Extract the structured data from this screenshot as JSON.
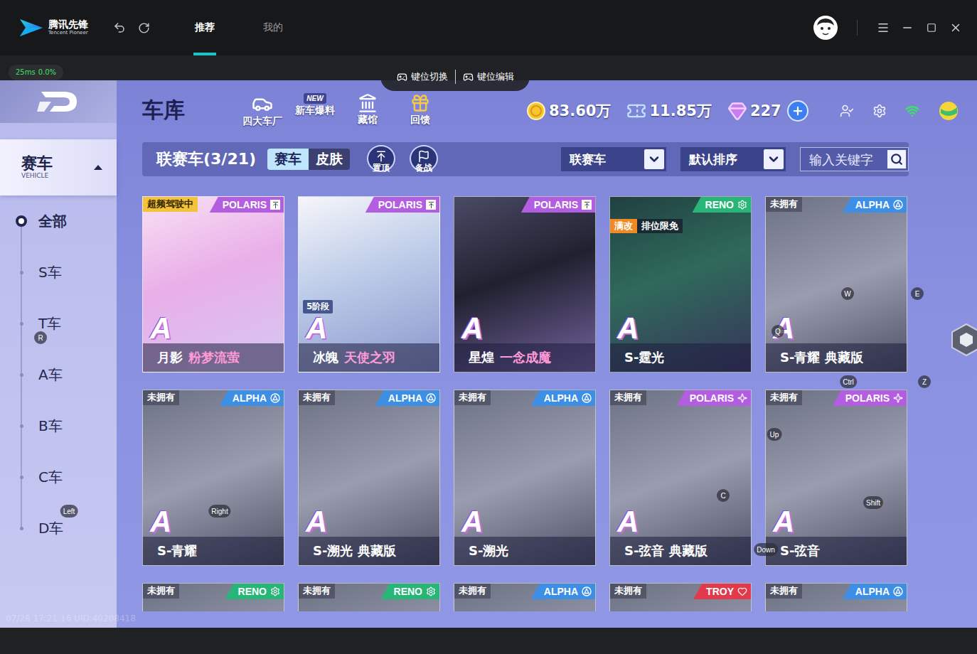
{
  "app": {
    "logo_text": "腾讯先锋",
    "logo_sub": "Tencent Pioneer"
  },
  "nav_tabs": [
    {
      "label": "推荐",
      "selected": true
    },
    {
      "label": "我的",
      "selected": false
    }
  ],
  "ping": {
    "latency": "25ms",
    "loss": "0.0%"
  },
  "key_mode_buttons": [
    "键位切换",
    "键位编辑"
  ],
  "garage": {
    "title": "车库",
    "shortcuts": [
      {
        "label": "四大车厂",
        "kind": "factory"
      },
      {
        "label": "新车爆料",
        "kind": "news"
      },
      {
        "label": "藏馆",
        "kind": "museum"
      },
      {
        "label": "回馈",
        "kind": "gift"
      }
    ],
    "new_badge": "NEW",
    "currencies": [
      {
        "value": "83.60万",
        "kind": "coin"
      },
      {
        "value": "11.85万",
        "kind": "ticket"
      },
      {
        "value": "227",
        "kind": "diamond"
      }
    ]
  },
  "sidebar": {
    "category": {
      "label": "赛车",
      "sub": "VEHICLE",
      "expanded": true
    },
    "items": [
      {
        "label": "全部",
        "selected": true
      },
      {
        "label": "S车",
        "selected": false
      },
      {
        "label": "T车",
        "selected": false
      },
      {
        "label": "A车",
        "selected": false
      },
      {
        "label": "B车",
        "selected": false
      },
      {
        "label": "C车",
        "selected": false
      },
      {
        "label": "D车",
        "selected": false
      }
    ]
  },
  "filter": {
    "title": "联赛车(3/21)",
    "toggle": [
      {
        "label": "赛车",
        "selected": true
      },
      {
        "label": "皮肤",
        "selected": false
      }
    ],
    "actions": [
      {
        "label": "置顶",
        "kind": "pin"
      },
      {
        "label": "备战",
        "kind": "flag"
      }
    ],
    "dropdowns": [
      "联赛车",
      "默认排序"
    ],
    "search_placeholder": "输入关键字"
  },
  "cards": [
    {
      "status": "超频驾驶中",
      "brand": "POLARIS",
      "brand_color": "#b35ee0",
      "pinned": true,
      "owned": true,
      "grade": "A",
      "name": "月影",
      "subname": "粉梦流萤"
    },
    {
      "brand": "POLARIS",
      "brand_color": "#b35ee0",
      "pinned": true,
      "owned": true,
      "stage": "5阶段",
      "grade": "A",
      "name": "冰魄",
      "subname": "天使之羽"
    },
    {
      "brand": "POLARIS",
      "brand_color": "#b35ee0",
      "pinned": true,
      "owned": true,
      "grade": "A",
      "name": "星煌",
      "subname": "一念成魔"
    },
    {
      "brand": "RENO",
      "brand_color": "#27b677",
      "pinned": false,
      "owned": true,
      "badges": [
        {
          "label": "满改",
          "kind": "highlight"
        },
        {
          "label": "排位限免",
          "kind": "plain"
        }
      ],
      "grade": "A",
      "name": "S-霆光"
    },
    {
      "status": "未拥有",
      "brand": "ALPHA",
      "brand_color": "#3d8fe6",
      "pinned": false,
      "owned": false,
      "grade": "A",
      "name": "S-青耀 典藏版"
    },
    {
      "status": "未拥有",
      "brand": "ALPHA",
      "brand_color": "#3d8fe6",
      "pinned": false,
      "owned": false,
      "grade": "A",
      "name": "S-青耀"
    },
    {
      "status": "未拥有",
      "brand": "ALPHA",
      "brand_color": "#3d8fe6",
      "pinned": false,
      "owned": false,
      "grade": "A",
      "name": "S-溯光 典藏版"
    },
    {
      "status": "未拥有",
      "brand": "ALPHA",
      "brand_color": "#3d8fe6",
      "pinned": false,
      "owned": false,
      "grade": "A",
      "name": "S-溯光"
    },
    {
      "status": "未拥有",
      "brand": "POLARIS",
      "brand_color": "#b35ee0",
      "pinned": false,
      "owned": false,
      "grade": "A",
      "name": "S-弦音 典藏版"
    },
    {
      "status": "未拥有",
      "brand": "POLARIS",
      "brand_color": "#b35ee0",
      "pinned": false,
      "owned": false,
      "grade": "A",
      "name": "S-弦音"
    },
    {
      "status": "未拥有",
      "brand": "RENO",
      "brand_color": "#27b677",
      "pinned": false,
      "owned": false
    },
    {
      "status": "未拥有",
      "brand": "RENO",
      "brand_color": "#27b677",
      "pinned": false,
      "owned": false
    },
    {
      "status": "未拥有",
      "brand": "ALPHA",
      "brand_color": "#3d8fe6",
      "pinned": false,
      "owned": false
    },
    {
      "status": "未拥有",
      "brand": "TROY",
      "brand_color": "#e23a4c",
      "pinned": false,
      "owned": false
    },
    {
      "status": "未拥有",
      "brand": "ALPHA",
      "brand_color": "#3d8fe6",
      "pinned": false,
      "owned": false
    }
  ],
  "key_hints": [
    "E",
    "W",
    "Q",
    "R",
    "Ctrl",
    "Z",
    "Up",
    "Shift",
    "C",
    "Down",
    "Right",
    "Left"
  ],
  "watermark": "07/28 17:21:16 UID:40208418"
}
